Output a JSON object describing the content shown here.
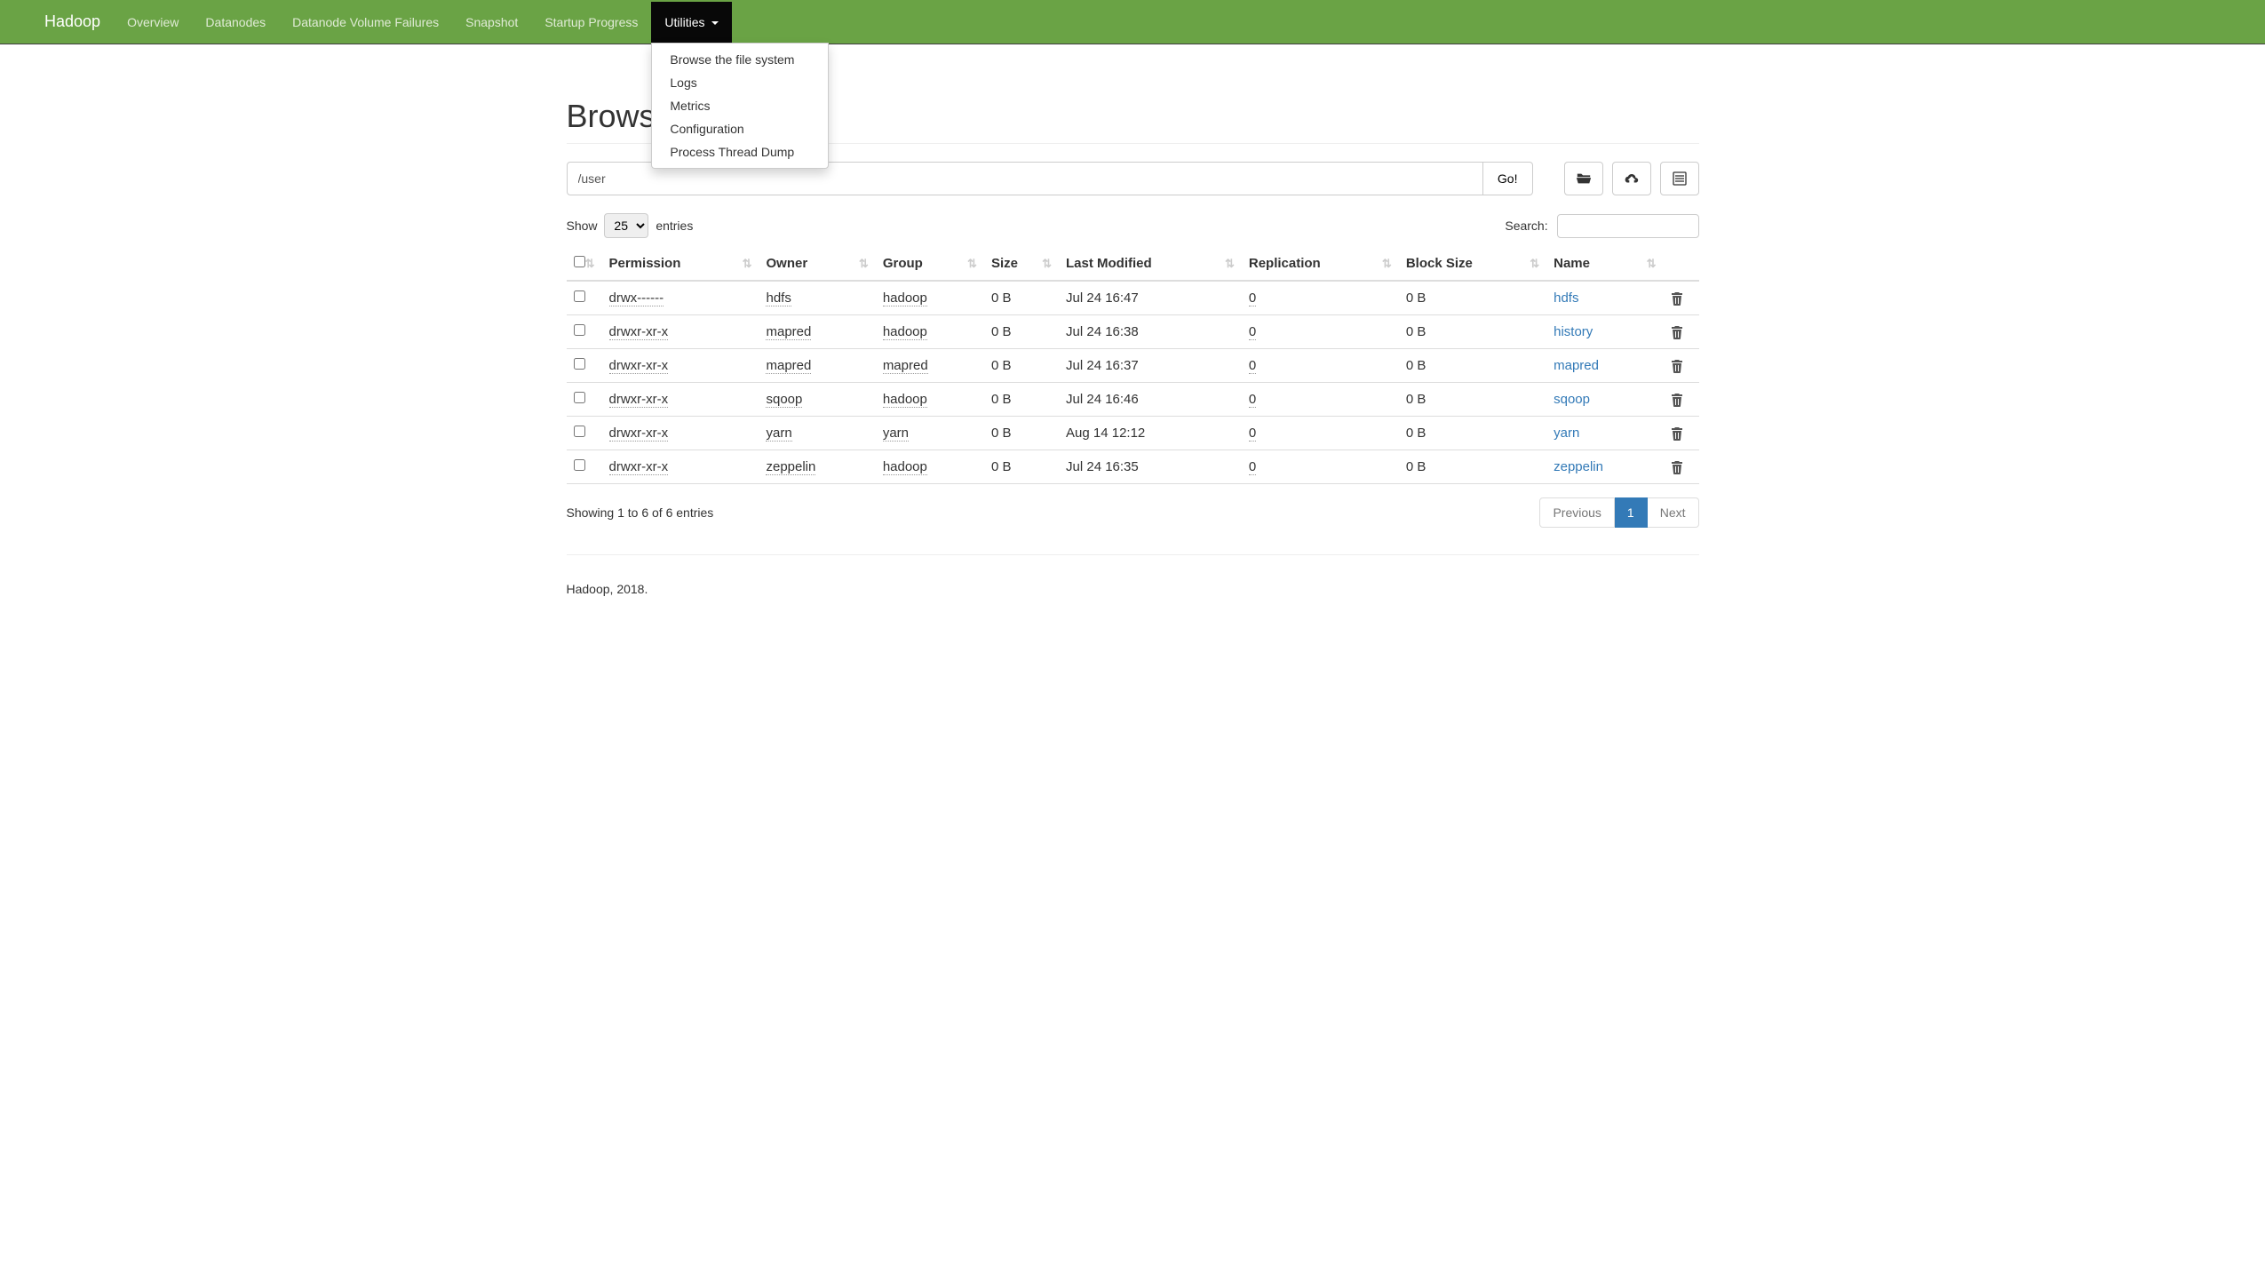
{
  "navbar": {
    "brand": "Hadoop",
    "items": [
      "Overview",
      "Datanodes",
      "Datanode Volume Failures",
      "Snapshot",
      "Startup Progress"
    ],
    "utilities_label": "Utilities",
    "dropdown": [
      "Browse the file system",
      "Logs",
      "Metrics",
      "Configuration",
      "Process Thread Dump"
    ]
  },
  "page_title": "Browse Directory",
  "path_input": "/user",
  "go_label": "Go!",
  "show_label": "Show",
  "entries_label": "entries",
  "show_value": "25",
  "search_label": "Search:",
  "columns": [
    "Permission",
    "Owner",
    "Group",
    "Size",
    "Last Modified",
    "Replication",
    "Block Size",
    "Name"
  ],
  "rows": [
    {
      "perm": "drwx------",
      "owner": "hdfs",
      "group": "hadoop",
      "size": "0 B",
      "modified": "Jul 24 16:47",
      "rep": "0",
      "block": "0 B",
      "name": "hdfs"
    },
    {
      "perm": "drwxr-xr-x",
      "owner": "mapred",
      "group": "hadoop",
      "size": "0 B",
      "modified": "Jul 24 16:38",
      "rep": "0",
      "block": "0 B",
      "name": "history"
    },
    {
      "perm": "drwxr-xr-x",
      "owner": "mapred",
      "group": "mapred",
      "size": "0 B",
      "modified": "Jul 24 16:37",
      "rep": "0",
      "block": "0 B",
      "name": "mapred"
    },
    {
      "perm": "drwxr-xr-x",
      "owner": "sqoop",
      "group": "hadoop",
      "size": "0 B",
      "modified": "Jul 24 16:46",
      "rep": "0",
      "block": "0 B",
      "name": "sqoop"
    },
    {
      "perm": "drwxr-xr-x",
      "owner": "yarn",
      "group": "yarn",
      "size": "0 B",
      "modified": "Aug 14 12:12",
      "rep": "0",
      "block": "0 B",
      "name": "yarn"
    },
    {
      "perm": "drwxr-xr-x",
      "owner": "zeppelin",
      "group": "hadoop",
      "size": "0 B",
      "modified": "Jul 24 16:35",
      "rep": "0",
      "block": "0 B",
      "name": "zeppelin"
    }
  ],
  "showing_text": "Showing 1 to 6 of 6 entries",
  "pagination": {
    "prev": "Previous",
    "page": "1",
    "next": "Next"
  },
  "footer": "Hadoop, 2018."
}
